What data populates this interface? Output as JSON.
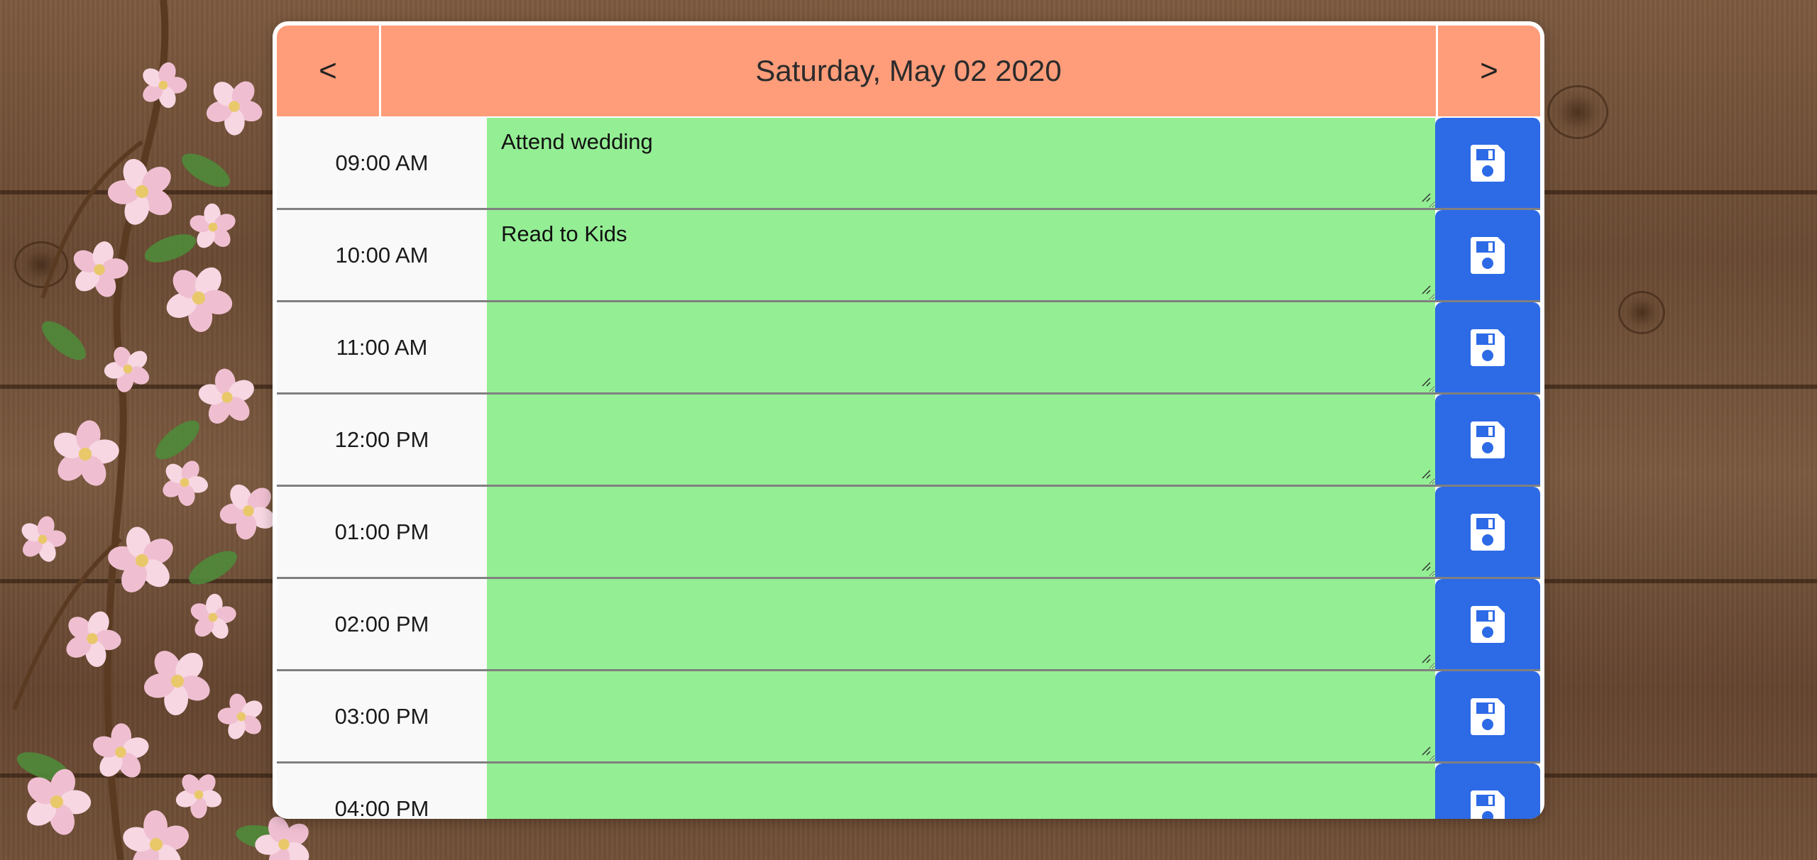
{
  "header": {
    "prev_label": "<",
    "next_label": ">",
    "date": "Saturday, May 02 2020"
  },
  "colors": {
    "header": "#ff9d7a",
    "event_future": "#94ee94",
    "save_button": "#2d6ae6",
    "hour_cell": "#f9f9f9"
  },
  "icons": {
    "save": "floppy-disk-icon",
    "resize": "resize-grip-icon"
  },
  "rows": [
    {
      "hour": "09:00 AM",
      "event": "Attend wedding"
    },
    {
      "hour": "10:00 AM",
      "event": "Read to Kids"
    },
    {
      "hour": "11:00 AM",
      "event": ""
    },
    {
      "hour": "12:00 PM",
      "event": ""
    },
    {
      "hour": "01:00 PM",
      "event": ""
    },
    {
      "hour": "02:00 PM",
      "event": ""
    },
    {
      "hour": "03:00 PM",
      "event": ""
    },
    {
      "hour": "04:00 PM",
      "event": ""
    }
  ]
}
